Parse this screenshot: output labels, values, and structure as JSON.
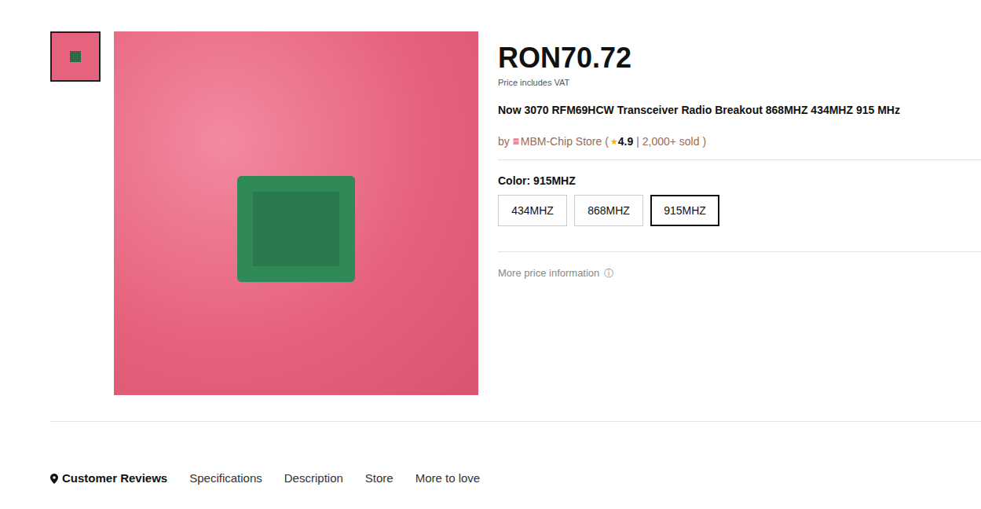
{
  "thumbnails": [
    {
      "selected": true
    }
  ],
  "price": "RON70.72",
  "price_note": "Price includes VAT",
  "title": "Now 3070 RFM69HCW Transceiver Radio Breakout 868MHZ 434MHZ 915 MHz",
  "seller": {
    "prefix": "by",
    "name": "MBM-Chip Store",
    "open": "(",
    "star": "★",
    "rating": "4.9",
    "sold": "| 2,000+ sold )"
  },
  "option_label": "Color: 915MHZ",
  "options": [
    {
      "label": "434MHZ",
      "selected": false
    },
    {
      "label": "868MHZ",
      "selected": false
    },
    {
      "label": "915MHZ",
      "selected": true
    }
  ],
  "more_price": "More price information",
  "info_icon": "ⓘ",
  "tabs": [
    {
      "label": "Customer Reviews",
      "selected": true
    },
    {
      "label": "Specifications",
      "selected": false
    },
    {
      "label": "Description",
      "selected": false
    },
    {
      "label": "Store",
      "selected": false
    },
    {
      "label": "More to love",
      "selected": false
    }
  ]
}
